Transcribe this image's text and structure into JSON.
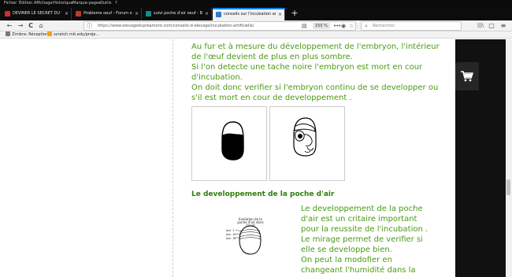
{
  "menu": [
    "Fichier",
    "Édition",
    "Affichage",
    "Historique",
    "Marque-pages",
    "Outils",
    "?"
  ],
  "tabs": [
    {
      "title": "DEVINER LE SECRET DU TOUR…",
      "favicon_color": "#d62b2b",
      "active": false
    },
    {
      "title": "Probleme oeuf - Forum oiseaux",
      "favicon_color": "#c0392b",
      "active": false
    },
    {
      "title": "suivi poche d'air oeuf - Bing",
      "favicon_color": "#138d90",
      "active": false
    },
    {
      "title": "conseils sur l'incubation artifici…",
      "favicon_color": "#2d7bd3",
      "active": true
    }
  ],
  "new_tab_label": "+",
  "nav": {
    "back": "←",
    "forward": "→",
    "reload": "C",
    "home": "⌂",
    "url": "https://www.elevagedupreamont.com/conseils-d-elevage/incubation-artificielle/",
    "zoom": "150 %",
    "more": "•••",
    "search_placeholder": "Rechercher",
    "library": "|||\\",
    "sidebar": "▢",
    "menu": "≡"
  },
  "bookmarks": [
    {
      "label": "Zimbra: Réception",
      "icon_color": "#777777"
    },
    {
      "label": "scratch.mit.edu/proje…",
      "icon_color": "#f2a31b"
    }
  ],
  "content": {
    "paragraph1": [
      "Au fur et à mesure du développement de l'embryon, l'intérieur",
      "de l'œuf devient de plus en plus sombre.",
      "Si l'on detecte une tache noire l'embryon est mort en cour",
      "d'incubation.",
      "On doit donc verifier si l'embryon continu de se developper ou",
      "s'il est mort en cour de developpement ."
    ],
    "section_heading": "Le developpement de la poche d'air",
    "diagram_caption": "Evolution de la poche d'air dans l'oeuf",
    "diagram_labels": [
      "Jour 1",
      "Jour 10",
      "Jour 18"
    ],
    "paragraph2": [
      "Le developpement de la poche",
      "d'air est un critaire important",
      "pour la reussite de l'incubation .",
      "Le mirage permet de verifier si",
      "elle se developpe bien.",
      "On peut la modofier en",
      "changeant l'humidité dans la"
    ]
  },
  "colors": {
    "text_green": "#4a9a14",
    "heading_green": "#2e7d0a",
    "side_panel": "#111111"
  }
}
